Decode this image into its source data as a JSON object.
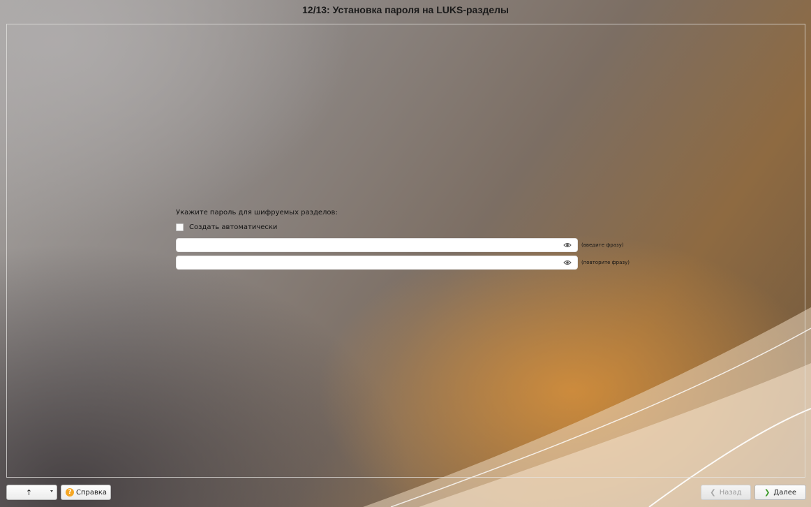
{
  "window": {
    "title": "12/13: Установка пароля на LUKS-разделы"
  },
  "form": {
    "prompt": "Укажите пароль для шифруемых разделов:",
    "auto_create": {
      "label": "Создать автоматически",
      "checked": false
    },
    "passphrase": {
      "value": "",
      "hint": "(введите фразу)",
      "toggle_icon": "eye-icon"
    },
    "passphrase_repeat": {
      "value": "",
      "hint": "(повторите фразу)",
      "toggle_icon": "eye-icon"
    }
  },
  "bottom_bar": {
    "up_button": {
      "icon": "arrow-up-icon",
      "label": "↑"
    },
    "help_button": {
      "icon": "help-icon",
      "label": "Справка"
    },
    "back_button": {
      "label": "Назад",
      "enabled": false
    },
    "next_button": {
      "label": "Далее",
      "enabled": true
    }
  },
  "colors": {
    "help_icon": "#f5a623",
    "next_chevron": "#3c9a2a"
  }
}
